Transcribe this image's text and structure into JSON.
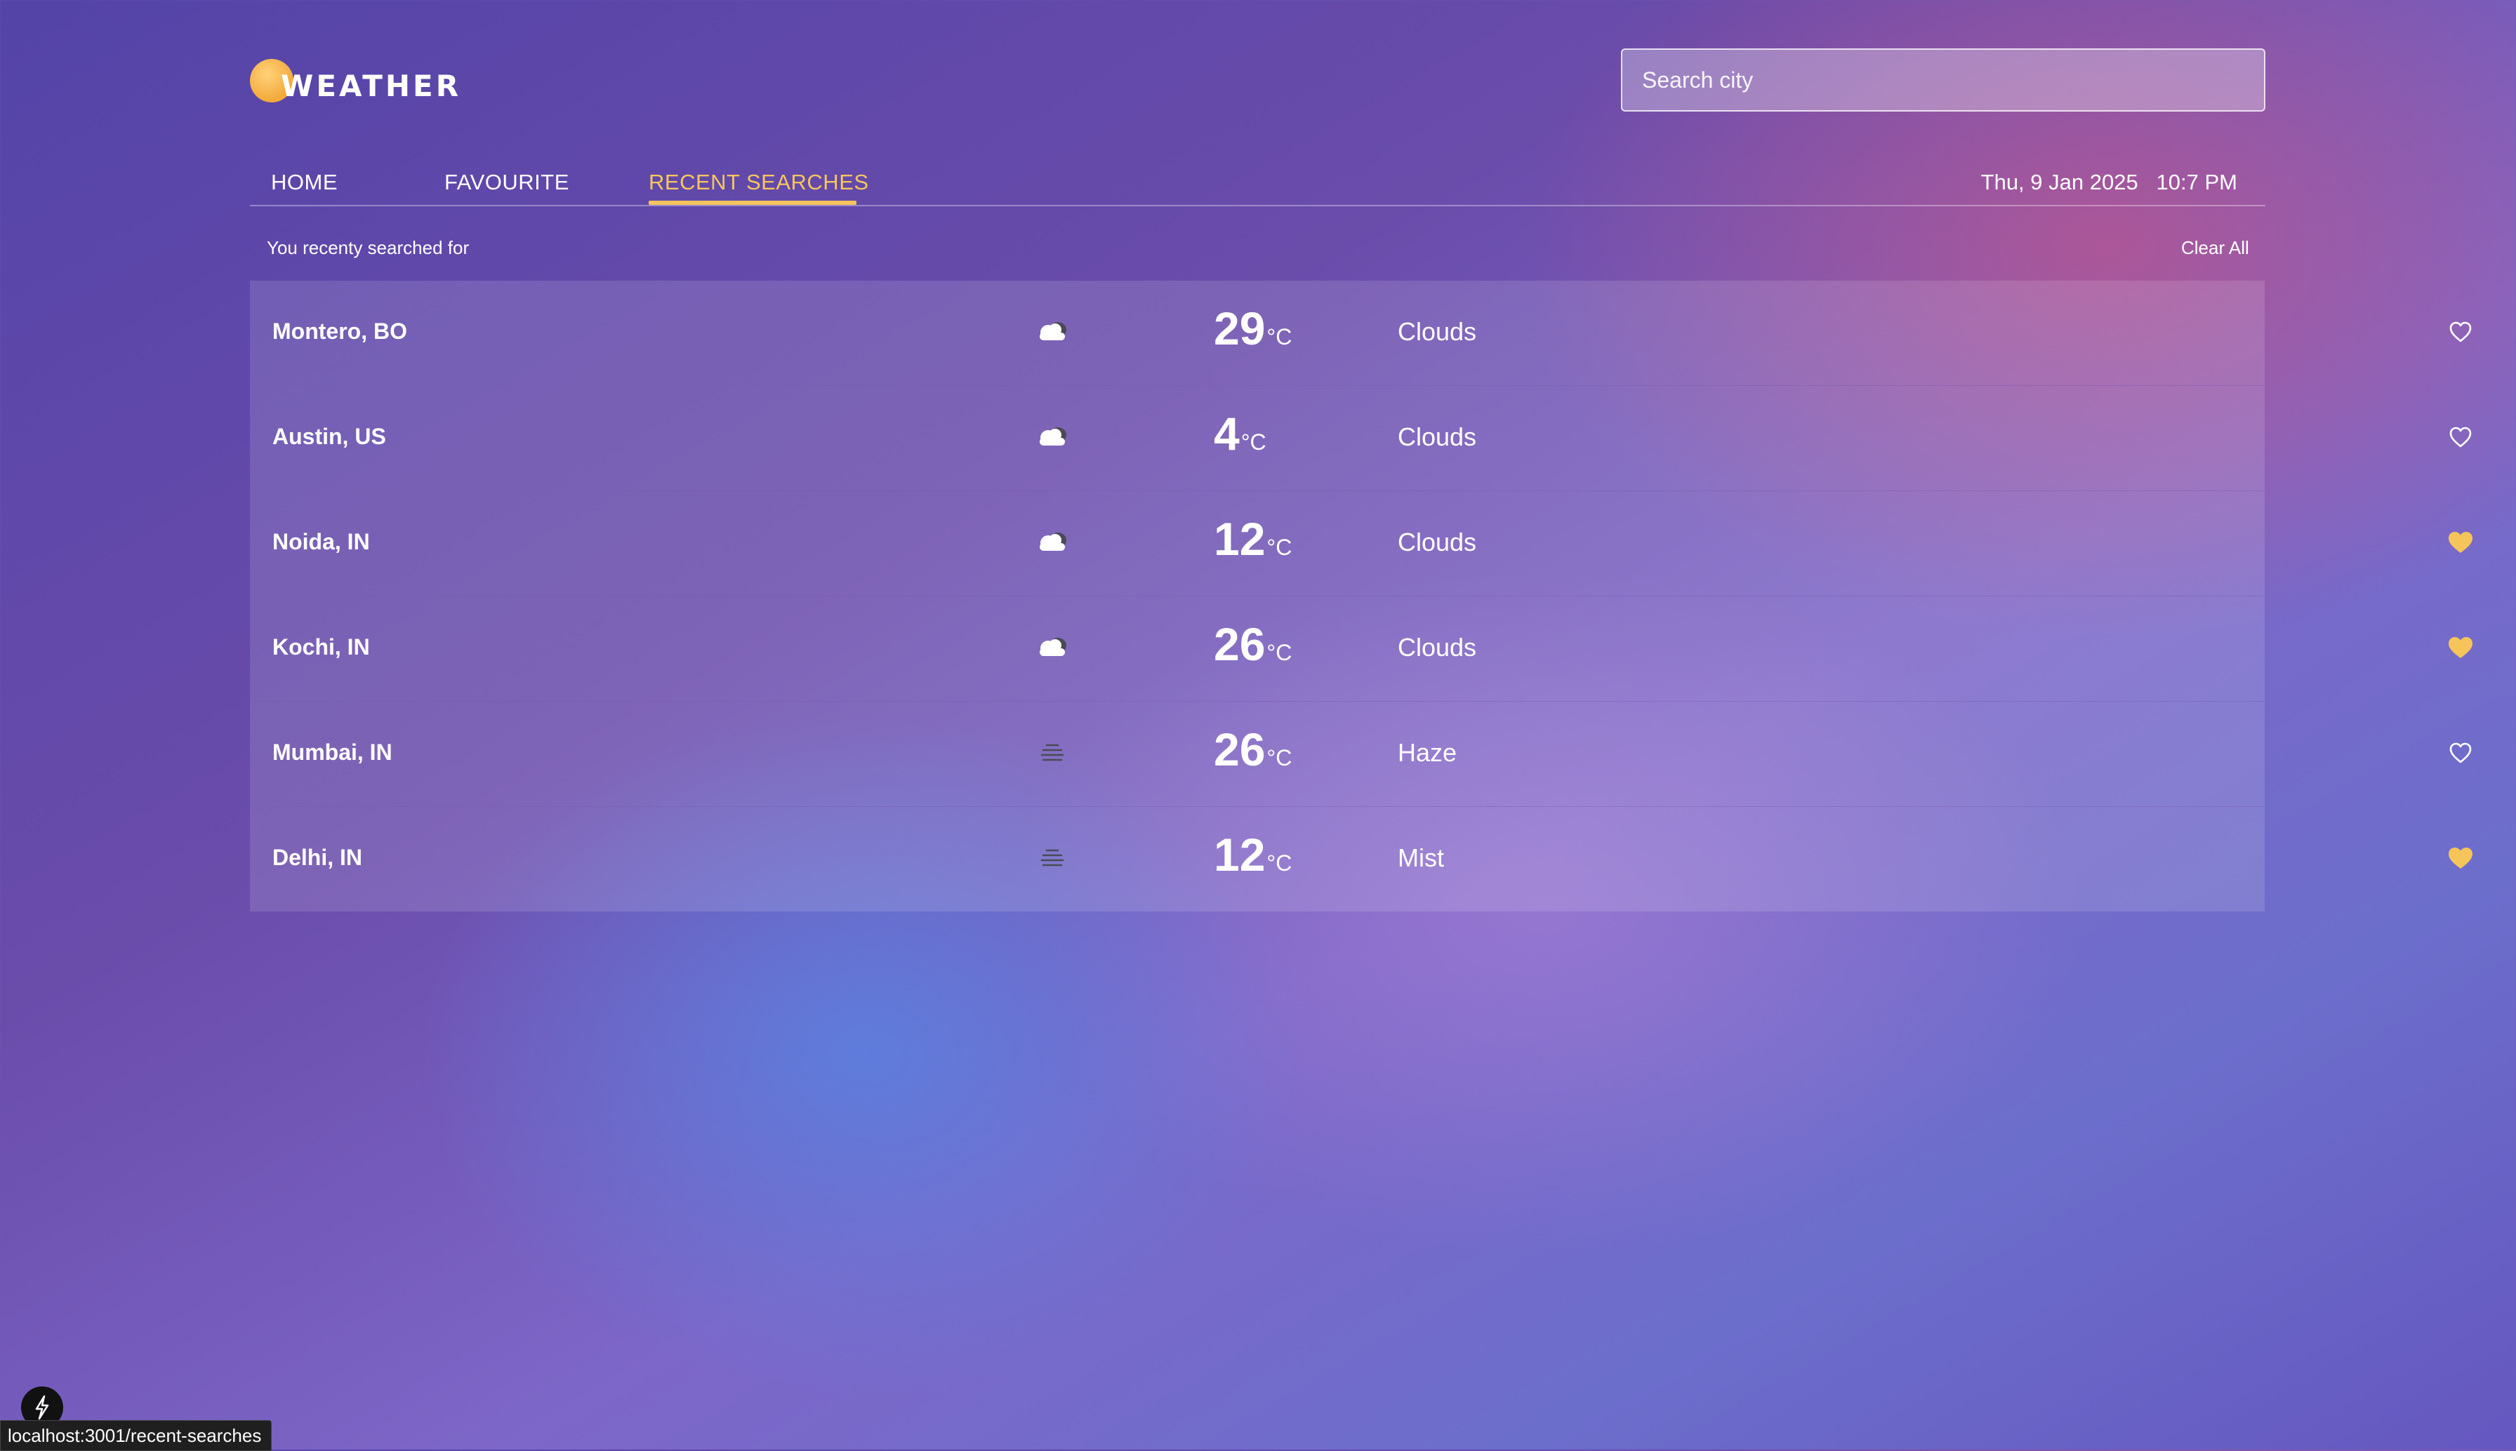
{
  "app": {
    "logo_text": "WEATHER"
  },
  "search": {
    "placeholder": "Search city",
    "value": ""
  },
  "nav": {
    "tabs": [
      "HOME",
      "FAVOURITE",
      "RECENT SEARCHES"
    ],
    "active_tab": "RECENT SEARCHES",
    "date": "Thu, 9 Jan 2025",
    "time": "10:7 PM"
  },
  "recent": {
    "subtitle": "You recenty searched for",
    "clear_all": "Clear All",
    "unit": "°C",
    "items": [
      {
        "city": "Montero, BO",
        "icon": "cloud-icon",
        "temp": "29",
        "condition": "Clouds",
        "favourite": false
      },
      {
        "city": "Austin, US",
        "icon": "cloud-icon",
        "temp": "4",
        "condition": "Clouds",
        "favourite": false
      },
      {
        "city": "Noida, IN",
        "icon": "cloud-icon",
        "temp": "12",
        "condition": "Clouds",
        "favourite": true
      },
      {
        "city": "Kochi, IN",
        "icon": "cloud-icon",
        "temp": "26",
        "condition": "Clouds",
        "favourite": true
      },
      {
        "city": "Mumbai, IN",
        "icon": "haze-icon",
        "temp": "26",
        "condition": "Haze",
        "favourite": false
      },
      {
        "city": "Delhi, IN",
        "icon": "mist-icon",
        "temp": "12",
        "condition": "Mist",
        "favourite": true
      }
    ]
  },
  "status_bar": {
    "url": "localhost:3001/recent-searches"
  },
  "colors": {
    "accent": "#f7c55d",
    "favourite_heart": "#f5c55a"
  }
}
